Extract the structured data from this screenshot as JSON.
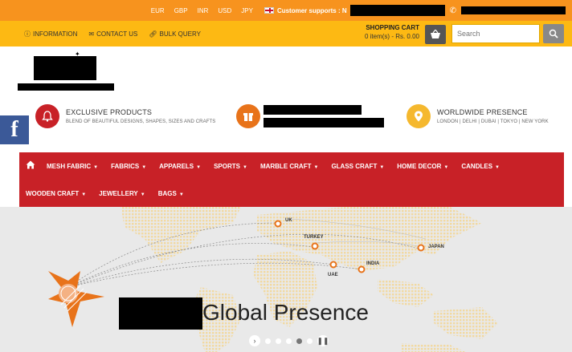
{
  "topbar": {
    "currencies": [
      "EUR",
      "GBP",
      "INR",
      "USD",
      "JPY"
    ],
    "support_label": "Customer supports : N"
  },
  "secbar": {
    "links": [
      {
        "label": "INFORMATION",
        "icon": "info-icon"
      },
      {
        "label": "CONTACT US",
        "icon": "envelope-icon"
      },
      {
        "label": "BULK QUERY",
        "icon": "link-icon"
      }
    ],
    "cart_title": "SHOPPING CART",
    "cart_summary": "0 item(s) - Rs. 0.00",
    "search_placeholder": "Search"
  },
  "facebook_label": "f",
  "features": [
    {
      "title": "EXCLUSIVE PRODUCTS",
      "subtitle": "BLEND OF BEAUTIFUL DESIGNS, SHAPES, SIZES AND CRAFTS",
      "icon": "bell-icon",
      "color": "#c82127"
    },
    {
      "title": "",
      "subtitle": "",
      "icon": "gift-icon",
      "color": "#e8731a"
    },
    {
      "title": "WORLDWIDE PRESENCE",
      "subtitle": "LONDON | DELHI | DUBAI | TOKYO | NEW YORK",
      "icon": "location-pin-icon",
      "color": "#f5b82e"
    }
  ],
  "nav": {
    "row1": [
      "MESH FABRIC",
      "FABRICS",
      "APPARELS",
      "SPORTS",
      "MARBLE CRAFT",
      "GLASS CRAFT",
      "HOME DECOR",
      "CANDLES"
    ],
    "row2": [
      "WOODEN CRAFT",
      "JEWELLERY",
      "BAGS"
    ]
  },
  "banner": {
    "title": "Global Presence",
    "cities": [
      "UK",
      "TURKEY",
      "JAPAN",
      "INDIA",
      "UAE"
    ]
  },
  "colors": {
    "topbar": "#f7931e",
    "secbar": "#fdb913",
    "nav": "#c82127",
    "accent_orange": "#e8731a"
  }
}
